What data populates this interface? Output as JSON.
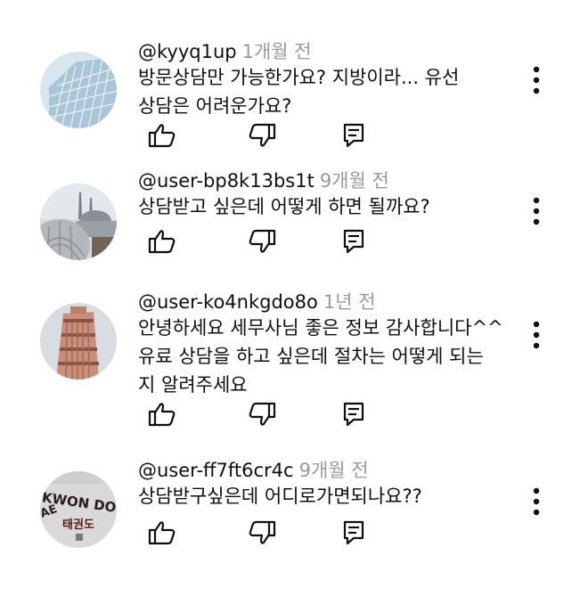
{
  "comments": [
    {
      "author": "@kyyq1up",
      "time": "1개월 전",
      "lines": [
        "방문상담만 가능한가요? 지방이라... 유선",
        "상담은 어려운가요?"
      ],
      "avatar": "glass-building-avatar"
    },
    {
      "author": "@user-bp8k13bs1t",
      "time": "9개월 전",
      "lines": [
        "상담받고 싶은데 어떻게 하면 될까요?"
      ],
      "avatar": "mosque-avatar"
    },
    {
      "author": "@user-ko4nkgdo8o",
      "time": "1년 전",
      "lines": [
        "안녕하세요 세무사님 좋은 정보 감사합니다^^",
        "유료 상담을 하고 싶은데 절차는 어떻게 되는",
        "지 알려주세요"
      ],
      "avatar": "leaning-tower-avatar"
    },
    {
      "author": "@user-ff7ft6cr4c",
      "time": "9개월 전",
      "lines": [
        "상담받구싶은데 어디로가면되나요??"
      ],
      "avatar": "taekwondo-avatar"
    }
  ],
  "avatar_logo_text": {
    "taekwondo": "KWON DO",
    "taekwondo_prefix": "AE",
    "taekwondo_korean": "태권도"
  },
  "icons": [
    "like-icon",
    "dislike-icon",
    "reply-icon",
    "more-vert-icon"
  ]
}
